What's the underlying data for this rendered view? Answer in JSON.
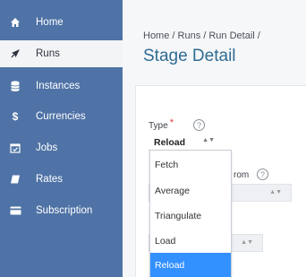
{
  "sidebar": {
    "items": [
      {
        "label": "Home",
        "icon": "home-icon",
        "active": false
      },
      {
        "label": "Runs",
        "icon": "rocket-icon",
        "active": true
      },
      {
        "label": "Instances",
        "icon": "database-icon",
        "active": false
      },
      {
        "label": "Currencies",
        "icon": "dollar-icon",
        "active": false
      },
      {
        "label": "Jobs",
        "icon": "calendar-check-icon",
        "active": false
      },
      {
        "label": "Rates",
        "icon": "book-icon",
        "active": false
      },
      {
        "label": "Subscription",
        "icon": "card-icon",
        "active": false
      }
    ]
  },
  "main": {
    "breadcrumb": "Home / Runs / Run Detail /",
    "title": "Stage Detail"
  },
  "form": {
    "type_label": "Type",
    "required_mark": "*",
    "help_glyph": "?",
    "type_value": "Reload",
    "from_label_partial": "rom"
  },
  "dropdown": {
    "options": [
      "Fetch",
      "Average",
      "Triangulate",
      "Load",
      "Reload"
    ],
    "selected": "Reload"
  },
  "colors": {
    "sidebar_bg": "#4f73a6",
    "title": "#2e6b93",
    "selected_option": "#3390ff"
  }
}
